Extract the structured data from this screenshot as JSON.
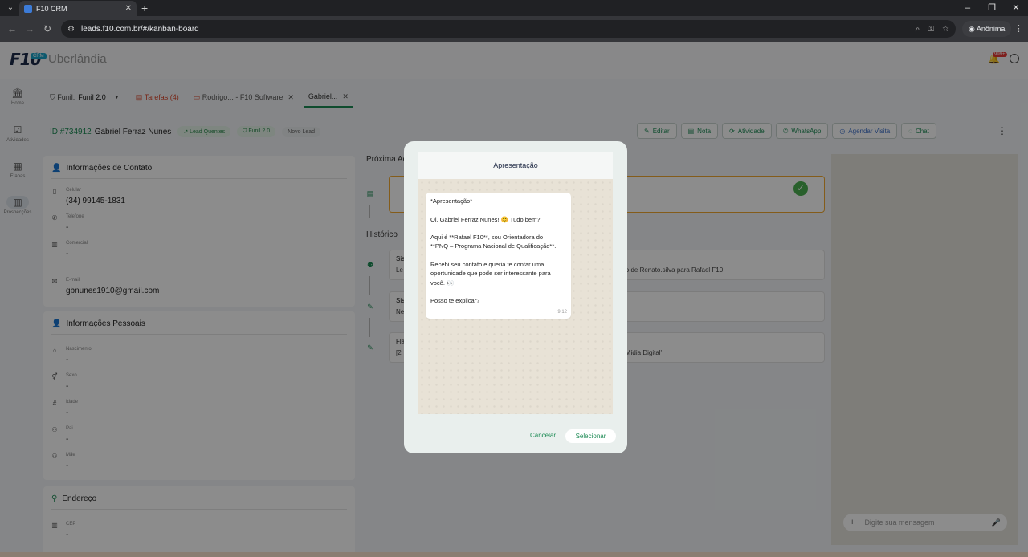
{
  "browser": {
    "tab_title": "F10 CRM",
    "url": "leads.f10.com.br/#/kanban-board",
    "incognito_label": "Anônima"
  },
  "app": {
    "logo": "F10",
    "logo_badge": "CRM",
    "city": "Uberlândia",
    "notification_badge": "999+"
  },
  "sidebar": {
    "items": [
      {
        "label": "Home",
        "icon": "bank-icon"
      },
      {
        "label": "Atividades",
        "icon": "checklist-icon"
      },
      {
        "label": "Etapas",
        "icon": "calendar-icon"
      },
      {
        "label": "Prospecções",
        "icon": "kanban-icon"
      }
    ]
  },
  "tabs": {
    "funil_label": "Funil:",
    "funil_value": "Funil 2.0",
    "tarefas": "Tarefas (4)",
    "rodrigo": "Rodrigo... - F10 Software",
    "gabriel": "Gabriel..."
  },
  "lead": {
    "id": "ID #734912",
    "name": "Gabriel Ferraz Nunes",
    "chips": [
      "Lead Quentes",
      "Funil 2.0",
      "Novo Lead"
    ]
  },
  "actions": [
    "Editar",
    "Nota",
    "Atividade",
    "WhatsApp",
    "Agendar Visita",
    "Chat"
  ],
  "contact": {
    "title": "Informações de Contato",
    "celular_label": "Celular",
    "celular_value": "(34) 99145-1831",
    "telefone_label": "Telefone",
    "telefone_value": "-",
    "comercial_label": "Comercial",
    "comercial_value": "-",
    "email_label": "E-mail",
    "email_value": "gbnunes1910@gmail.com"
  },
  "personal": {
    "title": "Informações Pessoais",
    "nascimento_label": "Nascimento",
    "nascimento_value": "-",
    "sexo_label": "Sexo",
    "sexo_value": "-",
    "idade_label": "Idade",
    "idade_value": "-",
    "pai_label": "Pai",
    "pai_value": "-",
    "mae_label": "Mãe",
    "mae_value": "-"
  },
  "address": {
    "title": "Endereço",
    "cep_label": "CEP",
    "cep_value": "-"
  },
  "middle": {
    "next_action_title": "Próxima Aç",
    "history_title": "Histórico",
    "history": [
      {
        "title": "Sis",
        "line": "Le",
        "tail": "lo de Renato.silva para Rafael F10"
      },
      {
        "title": "Sis",
        "line": "Ne",
        "tail": ""
      },
      {
        "title": "Fla",
        "line": "[2",
        "tail": "'Mídia Digital'"
      }
    ]
  },
  "chat": {
    "placeholder": "Digite sua mensagem"
  },
  "modal": {
    "title": "Apresentação",
    "message_lines": [
      "*Apresentação*",
      "",
      "Oi, Gabriel Ferraz Nunes! 😊 Tudo bem?",
      "",
      "Aqui é **Rafael F10**, sou Orientadora do",
      "**PNQ – Programa Nacional de Qualificação**.",
      "",
      "Recebi seu contato e queria te contar uma",
      "oportunidade que pode ser interessante para",
      "você. 👀",
      "",
      "Posso te explicar?"
    ],
    "time": "9:12",
    "cancel": "Cancelar",
    "select": "Selecionar"
  },
  "colors": {
    "accent": "#1d8b55",
    "warning": "#f0a830",
    "alert": "#d9452b"
  }
}
